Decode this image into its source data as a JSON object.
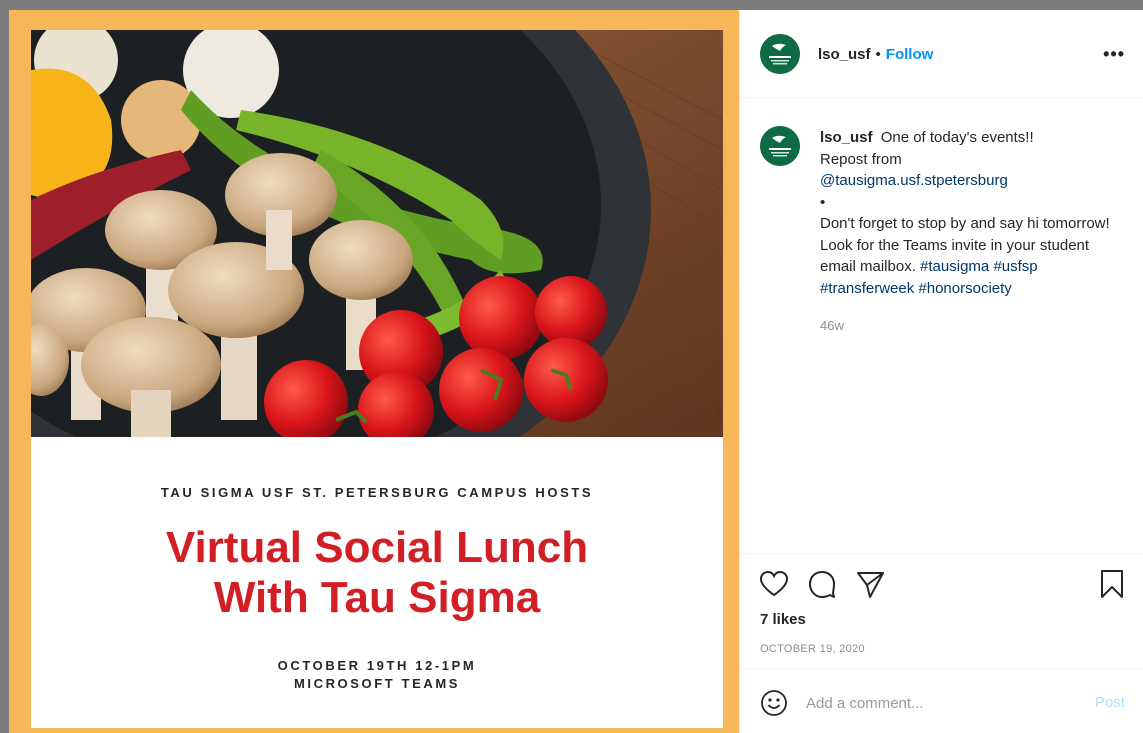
{
  "flyer": {
    "host_line": "TAU SIGMA USF ST. PETERSBURG CAMPUS HOSTS",
    "title_line1": "Virtual Social Lunch",
    "title_line2": "With Tau Sigma",
    "date_line": "OCTOBER 19TH 12-1PM",
    "platform_line": "MICROSOFT TEAMS"
  },
  "header": {
    "username": "lso_usf",
    "separator": "•",
    "follow_label": "Follow",
    "more_label": "•••"
  },
  "caption": {
    "username": "lso_usf",
    "text_1": "One of today's events!!",
    "text_2": "Repost from",
    "mention": "@tausigma.usf.stpetersburg",
    "bullet": "•",
    "text_3": "Don't forget to stop by and say hi tomorrow! Look for the Teams invite in your student email mailbox.",
    "hashtags": [
      "#tausigma",
      "#usfsp",
      "#transferweek",
      "#honorsociety"
    ],
    "time_ago": "46w"
  },
  "actions": {
    "likes": "7 likes",
    "date": "OCTOBER 19, 2020",
    "icons": [
      "heart-icon",
      "comment-icon",
      "share-icon",
      "bookmark-icon"
    ]
  },
  "comment": {
    "placeholder": "Add a comment...",
    "post_label": "Post"
  },
  "colors": {
    "frame": "#f7b658",
    "flyer_title": "#d21f26",
    "link": "#00376b",
    "follow": "#0095f6",
    "avatar": "#0f6b46"
  }
}
